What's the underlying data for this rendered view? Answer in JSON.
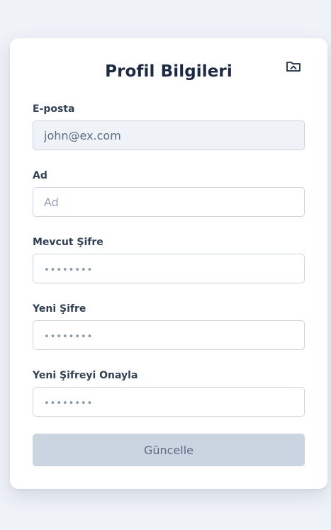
{
  "profile_form": {
    "title": "Profil Bilgileri",
    "header_icon": "folder-open-icon",
    "email": {
      "label": "E-posta",
      "value": "john@ex.com"
    },
    "name": {
      "label": "Ad",
      "placeholder": "Ad"
    },
    "current_password": {
      "label": "Mevcut Şifre",
      "placeholder": "••••••••"
    },
    "new_password": {
      "label": "Yeni Şifre",
      "placeholder": "••••••••"
    },
    "confirm_password": {
      "label": "Yeni Şifreyi Onayla",
      "placeholder": "••••••••"
    },
    "submit_label": "Güncelle"
  }
}
